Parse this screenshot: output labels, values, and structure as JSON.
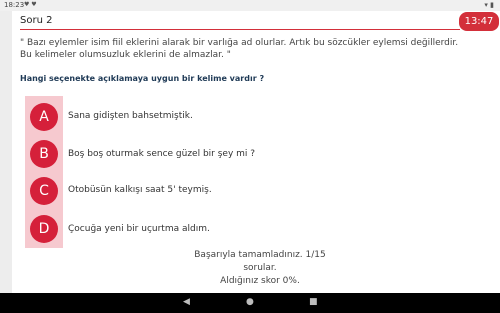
{
  "status_bar": {
    "time": "18:23",
    "notifications": "♥ ♥"
  },
  "header": {
    "title": "Soru 2",
    "timer": "13:47"
  },
  "question": {
    "statement": "\" Bazı eylemler isim fiil eklerini alarak bir varlığa ad olurlar. Artık bu sözcükler eylemsi değillerdir. Bu kelimeler olumsuzluk eklerini de almazlar. \"",
    "prompt": "Hangi seçenekte açıklamaya uygun bir kelime vardır ?"
  },
  "options": [
    {
      "letter": "A",
      "text": "Sana gidişten bahsetmiştik."
    },
    {
      "letter": "B",
      "text": "Boş boş oturmak sence güzel bir şey mi ?"
    },
    {
      "letter": "C",
      "text": "Otobüsün kalkışı saat 5' teymiş."
    },
    {
      "letter": "D",
      "text": "Çocuğa yeni bir uçurtma aldım."
    }
  ],
  "summary": {
    "line1": "Başarıyla tamamladınız. 1/15 sorular.",
    "line2": "Aldığınız skor 0%."
  },
  "navbar": {
    "back": "◀",
    "home": "●",
    "recents": "■"
  },
  "colors": {
    "accent": "#d32f3a",
    "option_circle": "#d5203a",
    "option_highlight": "#f6c9cf",
    "prompt_text": "#1f3a56"
  }
}
